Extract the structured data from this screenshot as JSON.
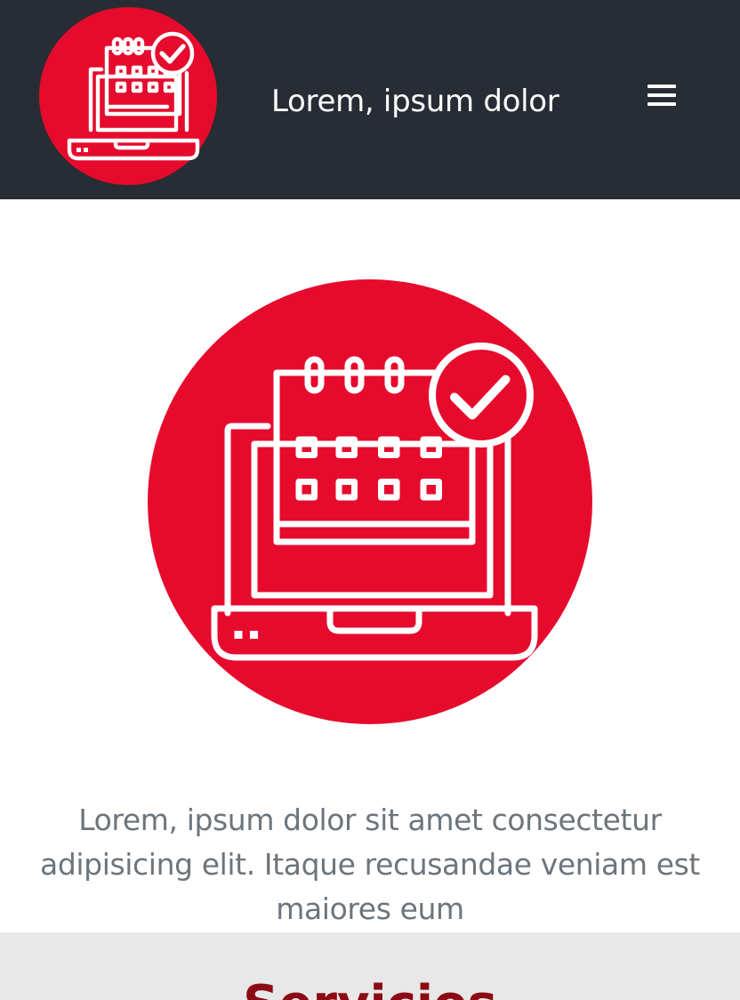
{
  "navbar": {
    "title": "Lorem, ipsum dolor",
    "logo_icon": "laptop-calendar-check-icon",
    "menu_icon": "hamburger-menu-icon"
  },
  "hero": {
    "icon": "laptop-calendar-check-icon",
    "description": "Lorem, ipsum dolor sit amet consectetur adipisicing elit. Itaque recusandae veniam est maiores eum"
  },
  "services": {
    "title": "Servicios"
  },
  "colors": {
    "navbar_bg": "#282c34",
    "brand_red": "#e60b2d",
    "heading_red": "#8b0a14",
    "text_gray": "#6c757d",
    "section_bg": "#e8e8e8"
  }
}
